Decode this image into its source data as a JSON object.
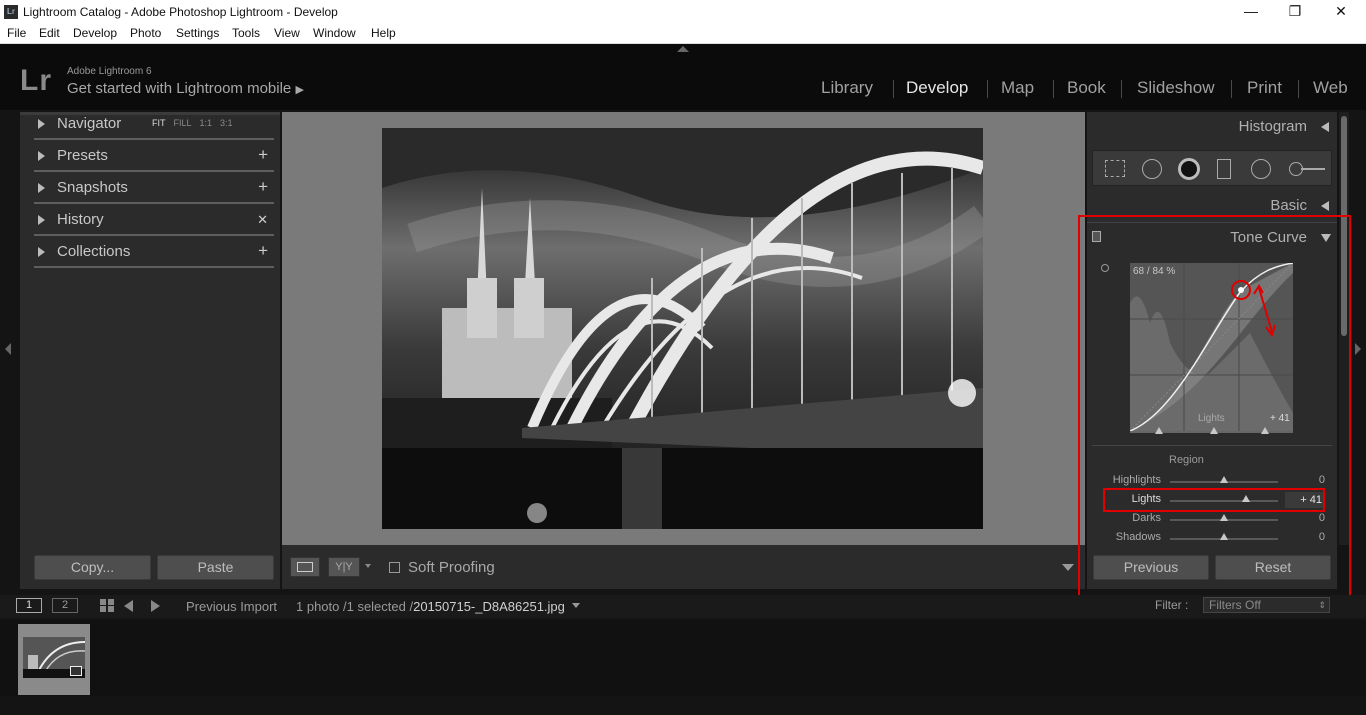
{
  "titlebar": {
    "title": "Lightroom Catalog - Adobe Photoshop Lightroom - Develop",
    "logo": "Lr",
    "minimize": "—",
    "maximize": "❐",
    "close": "✕"
  },
  "menubar": {
    "items": [
      "File",
      "Edit",
      "Develop",
      "Photo",
      "Settings",
      "Tools",
      "View",
      "Window",
      "Help"
    ]
  },
  "identity": {
    "logo": "Lr",
    "app": "Adobe Lightroom 6",
    "mobile": "Get started with Lightroom mobile",
    "mobile_arrow": "▶"
  },
  "modules": [
    "Library",
    "Develop",
    "Map",
    "Book",
    "Slideshow",
    "Print",
    "Web"
  ],
  "active_module": "Develop",
  "left_panel": {
    "navigator": {
      "label": "Navigator",
      "options": [
        "FIT",
        "FILL",
        "1:1",
        "3:1"
      ]
    },
    "presets": {
      "label": "Presets",
      "action": "+"
    },
    "snapshots": {
      "label": "Snapshots",
      "action": "+"
    },
    "history": {
      "label": "History",
      "action": "✕"
    },
    "collections": {
      "label": "Collections",
      "action": "+"
    },
    "copy_button": "Copy...",
    "paste_button": "Paste"
  },
  "toolbar": {
    "soft_proofing": "Soft Proofing",
    "yy": "Y|Y"
  },
  "right_panel": {
    "histogram": "Histogram",
    "basic": "Basic",
    "tone_curve": "Tone Curve",
    "curve_readout": "68 / 84 %",
    "curve_region_label": "Lights",
    "curve_region_value": "+ 41",
    "region_heading": "Region",
    "sliders": [
      {
        "label": "Highlights",
        "value": "0",
        "level": 0.5
      },
      {
        "label": "Lights",
        "value": "+ 41",
        "level": 0.7
      },
      {
        "label": "Darks",
        "value": "0",
        "level": 0.5
      },
      {
        "label": "Shadows",
        "value": "0",
        "level": 0.5
      }
    ],
    "previous_button": "Previous",
    "reset_button": "Reset"
  },
  "filmstrip_bar": {
    "page1": "1",
    "page2": "2",
    "source": "Previous Import",
    "count": "1 photo /1 selected /",
    "filename": "20150715-_D8A86251.jpg",
    "filter_label": "Filter :",
    "filter_value": "Filters Off"
  },
  "colors": {
    "highlight_red": "#e00000",
    "panel": "#2b2b2b",
    "canvas": "#7a7a7a"
  }
}
